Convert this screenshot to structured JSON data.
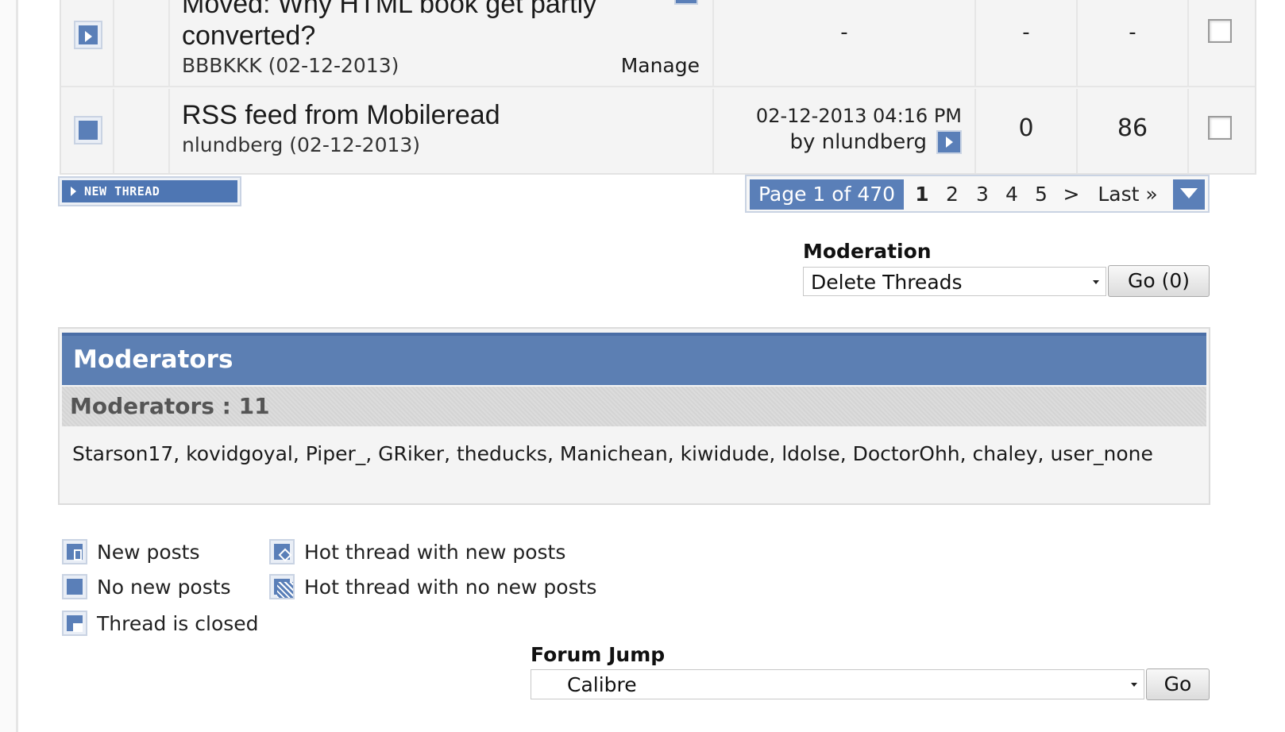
{
  "threads": [
    {
      "title": "Moved: Why HTML book get partly converted?",
      "title_line1": "Moved: Why HTML book get partly",
      "title_line2": "converted?",
      "author_date": "BBBKKK (02-12-2013)",
      "manage_label": "Manage",
      "last_post": "-",
      "replies": "-",
      "views": "-"
    },
    {
      "title": "RSS feed from Mobileread",
      "author_date": "nlundberg (02-12-2013)",
      "last_post_date": "02-12-2013 04:16 PM",
      "last_post_by": "by nlundberg",
      "replies": "0",
      "views": "86"
    }
  ],
  "new_thread_button": "NEW THREAD",
  "pagination": {
    "label": "Page 1 of 470",
    "pages": [
      "1",
      "2",
      "3",
      "4",
      "5"
    ],
    "current": "1",
    "next": ">",
    "last": "Last »"
  },
  "moderation": {
    "label": "Moderation",
    "selected": "Delete Threads",
    "go_button": "Go (0)"
  },
  "moderators_panel": {
    "title": "Moderators",
    "count_label": "Moderators : 11",
    "list": "Starson17, kovidgoyal, Piper_, GRiker, theducks, Manichean, kiwidude, ldolse, DoctorOhh, chaley, user_none"
  },
  "legend": {
    "new_posts": "New posts",
    "no_new_posts": "No new posts",
    "thread_closed": "Thread is closed",
    "hot_new": "Hot thread with new posts",
    "hot_no_new": "Hot thread with no new posts"
  },
  "forum_jump": {
    "label": "Forum Jump",
    "selected": "Calibre",
    "go_button": "Go"
  },
  "colors": {
    "accent": "#5a7fb8",
    "header": "#5c7fb3"
  }
}
